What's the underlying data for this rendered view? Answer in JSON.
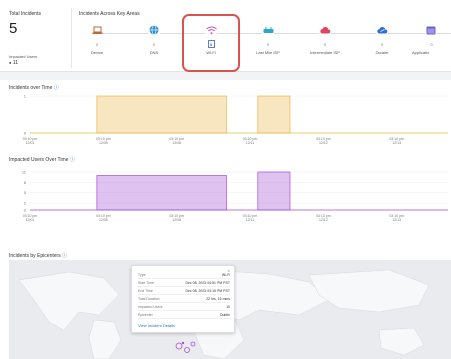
{
  "summary": {
    "total_title": "Total Incidents",
    "total_count": "5",
    "impacted_label": "Impacted Users",
    "impacted_value": "11"
  },
  "areas": {
    "title": "Incidents Across Key Areas",
    "items": [
      {
        "label": "Device",
        "count": "0",
        "icon": "laptop-icon",
        "color": "#c0653a"
      },
      {
        "label": "DNS",
        "count": "0",
        "icon": "globe-icon",
        "color": "#2f8fd0"
      },
      {
        "label": "Wi-Fi",
        "count": "5",
        "icon": "wifi-icon",
        "color": "#c054c8"
      },
      {
        "label": "Last Mile ISP",
        "count": "0",
        "icon": "router-icon",
        "color": "#2aa7c9"
      },
      {
        "label": "Intermediate ISP",
        "count": "0",
        "icon": "cloud-icon",
        "color": "#e1435e"
      },
      {
        "label": "Zscaler",
        "count": "0",
        "icon": "zscaler-cloud-icon",
        "color": "#2e6fd8"
      },
      {
        "label": "Applicatio",
        "count": "0",
        "icon": "app-window-icon",
        "color": "#6b5fd6"
      }
    ]
  },
  "incidents_chart": {
    "title": "Incidents over Time",
    "chart_data": {
      "type": "area",
      "color": "#e8b84a",
      "ylim": [
        0,
        1
      ],
      "yticks": [
        "1",
        "0"
      ],
      "xticks": [
        {
          "time": "03:10 pm",
          "date": "12/01"
        },
        {
          "time": "03:10 pm",
          "date": "12/05"
        },
        {
          "time": "03:10 pm",
          "date": "12/08"
        },
        {
          "time": "03:10 pm",
          "date": "12/11"
        },
        {
          "time": "03:10 pm",
          "date": "12/12"
        },
        {
          "time": "03:10 pm",
          "date": "12/13"
        }
      ],
      "series": [
        {
          "spans": [
            [
              0.16,
              0.47,
              1
            ],
            [
              0.545,
              0.622,
              1
            ]
          ]
        }
      ]
    }
  },
  "users_chart": {
    "title": "Impacted Users Over Time",
    "chart_data": {
      "type": "area",
      "color": "#a64fd8",
      "ylim": [
        0,
        11
      ],
      "yticks": [
        "11",
        "8",
        "5",
        "2",
        "0"
      ],
      "xticks": [
        {
          "time": "03:10 pm",
          "date": "12/01"
        },
        {
          "time": "03:10 pm",
          "date": "12/05"
        },
        {
          "time": "03:10 pm",
          "date": "12/08"
        },
        {
          "time": "03:10 pm",
          "date": "12/11"
        },
        {
          "time": "03:10 pm",
          "date": "12/12"
        },
        {
          "time": "03:10 pm",
          "date": "12/13"
        }
      ],
      "series": [
        {
          "spans": [
            [
              0.16,
              0.47,
              10
            ],
            [
              0.545,
              0.622,
              11
            ]
          ]
        }
      ]
    }
  },
  "epicenters": {
    "title": "Incidents by Epicenters",
    "popup": {
      "close": "×",
      "rows": [
        {
          "k": "Type",
          "v": "Wi-Fi"
        },
        {
          "k": "Start Time",
          "v": "Dec 08, 2023 04:51 PM PST"
        },
        {
          "k": "End Time",
          "v": "Dec 08, 2023 03:15 PM PST"
        },
        {
          "k": "Total Duration",
          "v": "22 hrs, 16 mins"
        },
        {
          "k": "Impacted Users",
          "v": "10"
        },
        {
          "k": "Epicenter",
          "v": "Dublin"
        }
      ],
      "link": "View Incident Details"
    }
  }
}
